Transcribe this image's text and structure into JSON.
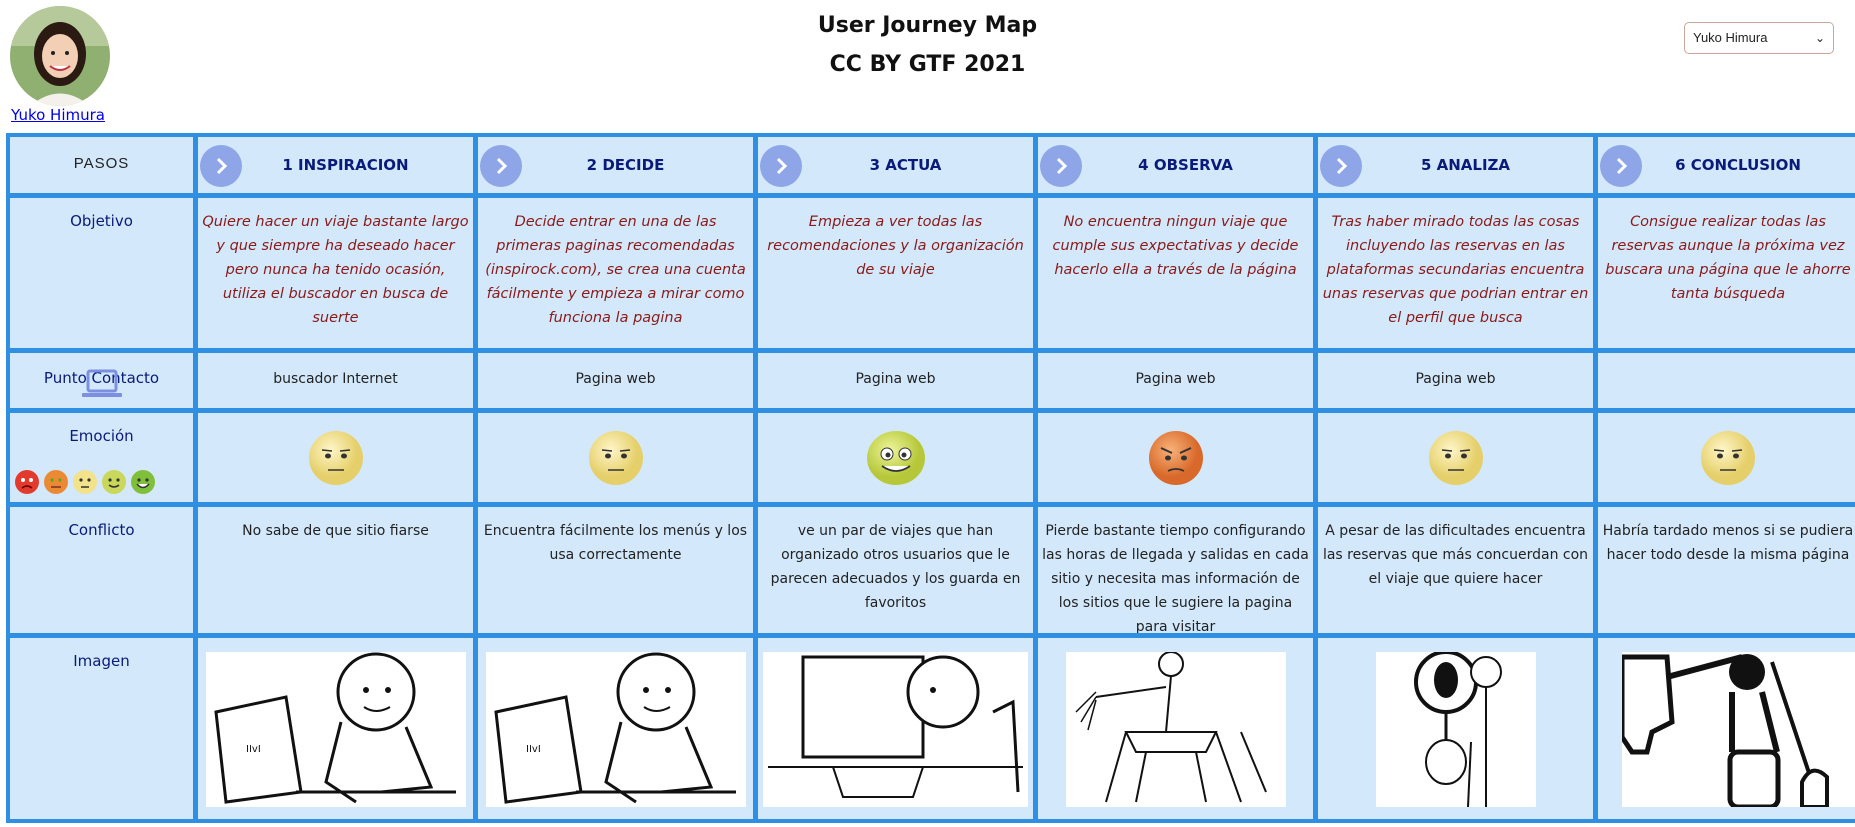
{
  "header": {
    "title": "User Journey Map",
    "subtitle": "CC BY GTF 2021"
  },
  "profile": {
    "name": "Yuko Himura"
  },
  "user_select": {
    "selected": "Yuko Himura"
  },
  "rows": {
    "pasos": "PASOS",
    "objetivo": "Objetivo",
    "punto_contacto": "Punto Contacto",
    "emocion": "Emoción",
    "conflicto": "Conflicto",
    "imagen": "Imagen"
  },
  "steps": [
    {
      "label": "1 INSPIRACION",
      "objective": "Quiere hacer un viaje bastante largo y que siempre ha deseado hacer pero nunca ha tenido ocasión, utiliza el buscador en busca de suerte",
      "touchpoint": "buscador Internet",
      "emotion": "neutral",
      "conflict": "No sabe de que sitio fiarse"
    },
    {
      "label": "2 DECIDE",
      "objective": "Decide entrar en una de las primeras paginas recomendadas (inspirock.com), se crea una cuenta fácilmente y empieza a mirar como funciona la pagina",
      "touchpoint": "Pagina web",
      "emotion": "neutral",
      "conflict": "Encuentra fácilmente los menús y los usa correctamente"
    },
    {
      "label": "3 ACTUA",
      "objective": "Empieza a ver todas las recomendaciones y la organización de su viaje",
      "touchpoint": "Pagina web",
      "emotion": "happy",
      "conflict": "ve un par de viajes que han organizado otros usuarios que le parecen adecuados y los guarda en favoritos"
    },
    {
      "label": "4 OBSERVA",
      "objective": "No encuentra ningun viaje que cumple sus expectativas y decide hacerlo ella a través de la página",
      "touchpoint": "Pagina web",
      "emotion": "annoyed",
      "conflict": "Pierde bastante tiempo configurando las horas de llegada y salidas en cada sitio y necesita mas información de los sitios que le sugiere la pagina para visitar"
    },
    {
      "label": "5 ANALIZA",
      "objective": "Tras haber mirado todas las cosas incluyendo las reservas en las plataformas secundarias encuentra unas reservas que podrian entrar en el perfil que busca",
      "touchpoint": "Pagina web",
      "emotion": "neutral",
      "conflict": "A pesar de las dificultades encuentra las reservas que más concuerdan con el viaje que quiere hacer"
    },
    {
      "label": "6 CONCLUSION",
      "objective": "Consigue realizar todas las reservas aunque la próxima vez buscara una página que le ahorre tanta búsqueda",
      "touchpoint": "",
      "emotion": "neutral",
      "conflict": "Habría tardado menos si se pudiera hacer todo desde la misma página"
    }
  ],
  "colors": {
    "grid_border": "#2e8fe3",
    "cell_bg": "#d3e9fb",
    "heading": "#0a1a7a",
    "objective_text": "#8a1a1a",
    "arrow_bg": "#8ea6e8"
  },
  "icons": {
    "emotion_scale": [
      "very-angry",
      "angry",
      "neutral",
      "pleased",
      "happy"
    ]
  }
}
